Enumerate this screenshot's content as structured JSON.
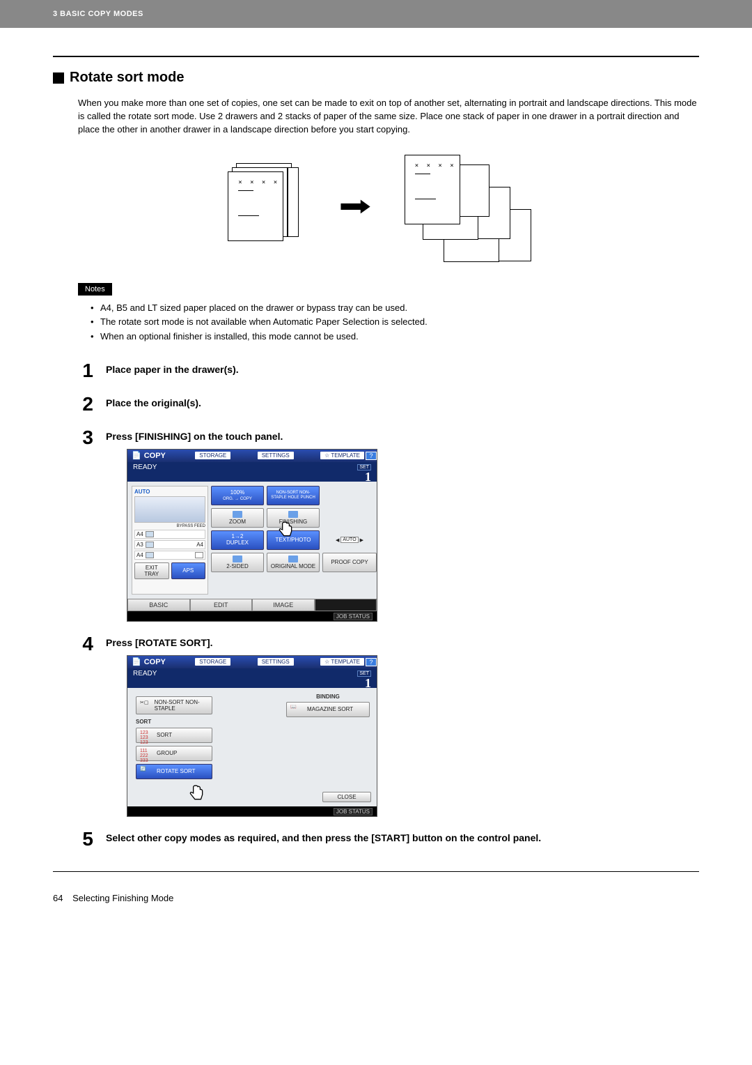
{
  "header": {
    "chapter": "3 BASIC COPY MODES"
  },
  "section": {
    "title": "Rotate sort mode"
  },
  "intro": "When you make more than one set of copies, one set can be made to exit on top of another set, alternating in portrait and landscape directions. This mode is called the rotate sort mode. Use 2 drawers and 2 stacks of paper of the same size. Place one stack of paper in one drawer in a portrait direction and place the other in another drawer in a landscape direction before you start copying.",
  "notes": {
    "label": "Notes",
    "items": [
      "A4, B5 and LT sized paper placed on the drawer or bypass tray can be used.",
      "The rotate sort mode is not available when Automatic Paper Selection is selected.",
      "When an optional finisher is installed, this mode cannot be used."
    ]
  },
  "steps": [
    {
      "num": "1",
      "title": "Place paper in the drawer(s)."
    },
    {
      "num": "2",
      "title": "Place the original(s)."
    },
    {
      "num": "3",
      "title": "Press [FINISHING] on the touch panel."
    },
    {
      "num": "4",
      "title": "Press [ROTATE SORT]."
    },
    {
      "num": "5",
      "title": "Select other copy modes as required, and then press the [START] button on the control panel."
    }
  ],
  "panel_common": {
    "copy": "COPY",
    "storage": "STORAGE",
    "settings": "SETTINGS",
    "template": "TEMPLATE",
    "help": "?",
    "ready": "READY",
    "set": "SET",
    "count": "1",
    "job_status": "JOB STATUS"
  },
  "panel1": {
    "auto": "AUTO",
    "bypass": "BYPASS FEED",
    "paper": [
      "A4",
      "A3",
      "A4"
    ],
    "a4_small": "A4",
    "exit": "EXIT TRAY",
    "aps": "APS",
    "pct": "100%",
    "orgcopy": "ORG. → COPY",
    "zoom": "ZOOM",
    "duplex_arrow": "1→2",
    "duplex": "DUPLEX",
    "twosided": "2-SIDED",
    "nonsort": "NON-SORT NON-STAPLE HOLE PUNCH",
    "finishing": "FINISHING",
    "textphoto": "TEXT/PHOTO",
    "original_mode": "ORIGINAL MODE",
    "autobtn": "AUTO",
    "proof": "PROOF COPY",
    "tabs": {
      "basic": "BASIC",
      "edit": "EDIT",
      "image": "IMAGE"
    }
  },
  "panel2": {
    "nonsort": "NON-SORT NON-STAPLE",
    "sort_label": "SORT",
    "sort": "SORT",
    "group": "GROUP",
    "rotate": "ROTATE SORT",
    "binding_label": "BINDING",
    "magazine": "MAGAZINE SORT",
    "close": "CLOSE"
  },
  "footer": {
    "page": "64",
    "title": "Selecting Finishing Mode"
  }
}
